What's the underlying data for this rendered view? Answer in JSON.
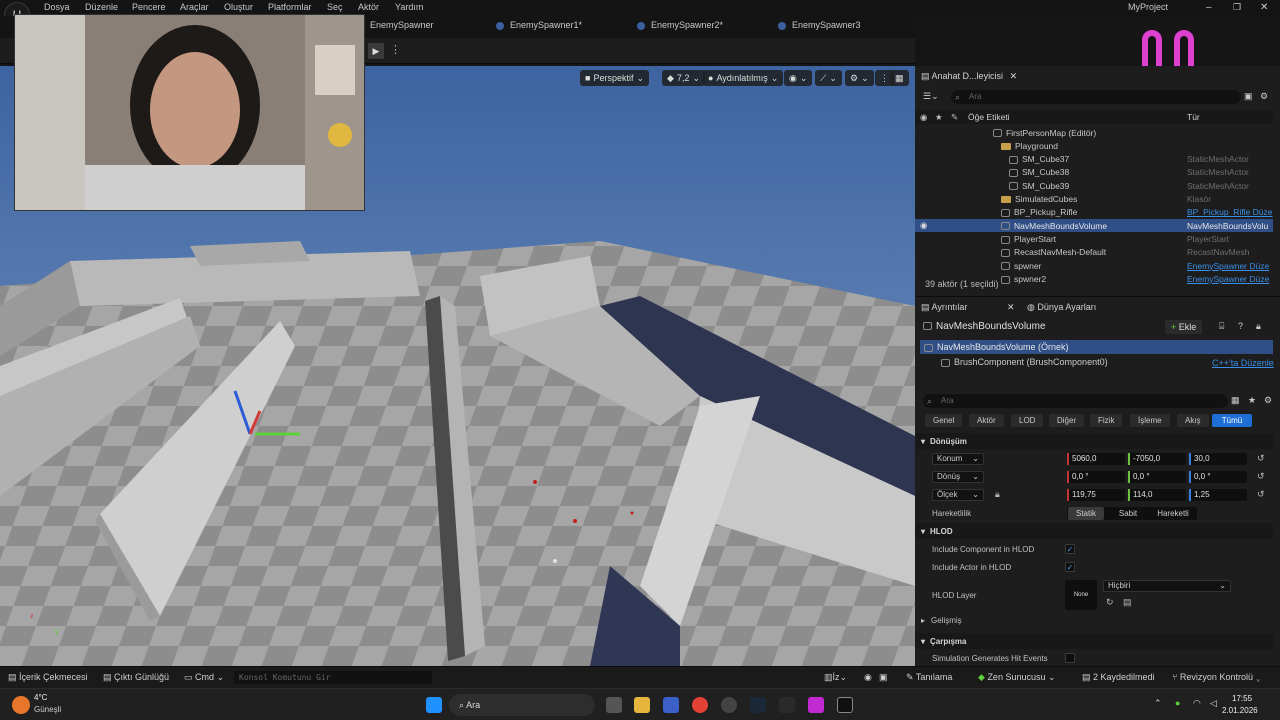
{
  "menu": {
    "items": [
      "Dosya",
      "Düzenle",
      "Pencere",
      "Araçlar",
      "Oluştur",
      "Platformlar",
      "Seç",
      "Aktör",
      "Yardım"
    ],
    "project_name": "MyProject"
  },
  "level_tabs": [
    "EnemySpawner",
    "EnemySpawner1*",
    "EnemySpawner2*",
    "EnemySpawner3"
  ],
  "viewport": {
    "view_mode": "Perspektif",
    "fov": "7,2",
    "lighting": "Aydınlatılmış"
  },
  "outliner": {
    "tab_title": "Anahat D...leyicisi",
    "search_placeholder": "Ara",
    "col_label": "Öğe Etiketi",
    "col_type": "Tür",
    "rows": [
      {
        "label": "FirstPersonMap (Editör)",
        "type": "",
        "kind": "map"
      },
      {
        "label": "Playground",
        "type": "",
        "kind": "folder"
      },
      {
        "label": "SM_Cube37",
        "type": "StaticMeshActor",
        "kind": "mesh"
      },
      {
        "label": "SM_Cube38",
        "type": "StaticMeshActor",
        "kind": "mesh"
      },
      {
        "label": "SM_Cube39",
        "type": "StaticMeshActor",
        "kind": "mesh"
      },
      {
        "label": "SimulatedCubes",
        "type": "Klasör",
        "kind": "folder"
      },
      {
        "label": "BP_Pickup_Rifle",
        "type": "BP_Pickup_Rifle Düze",
        "kind": "actor",
        "link": true
      },
      {
        "label": "NavMeshBoundsVolume",
        "type": "NavMeshBoundsVolu",
        "kind": "actor",
        "selected": true
      },
      {
        "label": "PlayerStart",
        "type": "PlayerStart",
        "kind": "actor"
      },
      {
        "label": "RecastNavMesh-Default",
        "type": "RecastNavMesh",
        "kind": "actor"
      },
      {
        "label": "spwner",
        "type": "EnemySpawner Düze",
        "kind": "actor",
        "link": true
      },
      {
        "label": "spwner2",
        "type": "EnemySpawner Düze",
        "kind": "actor",
        "link": true
      }
    ],
    "status": "39 aktör (1 seçildi)"
  },
  "details": {
    "tab_details": "Ayrıntılar",
    "tab_world": "Dünya Ayarları",
    "actor_name": "NavMeshBoundsVolume",
    "add_label": "Ekle",
    "instance_label": "NavMeshBoundsVolume (Örnek)",
    "component_label": "BrushComponent (BrushComponent0)",
    "cpp_link": "C++'ta Düzenle",
    "search_placeholder": "Ara",
    "filters": [
      "Genel",
      "Aktör",
      "LOD",
      "Diğer",
      "Fizik",
      "İşleme",
      "Akış",
      "Tümü"
    ],
    "transform": {
      "section": "Dönüşüm",
      "location_label": "Konum",
      "location": [
        "5060,0",
        "-7050,0",
        "30,0"
      ],
      "rotation_label": "Dönüş",
      "rotation": [
        "0,0 °",
        "0,0 °",
        "0,0 °"
      ],
      "scale_label": "Ölçek",
      "scale": [
        "119,75",
        "114,0",
        "1,25"
      ],
      "mobility_label": "Hareketlilik",
      "mobility_options": [
        "Statik",
        "Sabit",
        "Hareketli"
      ],
      "mobility_selected": "Statik"
    },
    "hlod": {
      "section": "HLOD",
      "include_component": "Include Component in HLOD",
      "include_actor": "Include Actor in HLOD",
      "layer_label": "HLOD Layer",
      "layer_thumb": "None",
      "layer_value": "Hiçbiri"
    },
    "advanced": "Gelişmiş",
    "collision": {
      "section": "Çarpışma",
      "sim_hit": "Simulation Generates Hit Events"
    }
  },
  "bottom_bar": {
    "content_drawer": "İçerik Çekmecesi",
    "output_log": "Çıktı Günlüğü",
    "cmd": "Cmd",
    "console_placeholder": "Konsol Komutunu Gir",
    "trace": "İz",
    "derive": "Tanılama",
    "zen": "Zen Sunucusu",
    "saved": "2 Kaydedilmedi",
    "revision": "Revizyon Kontrolü"
  },
  "taskbar": {
    "weather_temp": "4°C",
    "weather_desc": "Güneşli",
    "search_label": "Ara",
    "time": "17:55",
    "date": "2.01.2026"
  },
  "colors": {
    "accent": "#1f6fd6",
    "selected_row": "#2f4f86",
    "sky": "#4a6fa5",
    "smiley": "#e040d0"
  }
}
